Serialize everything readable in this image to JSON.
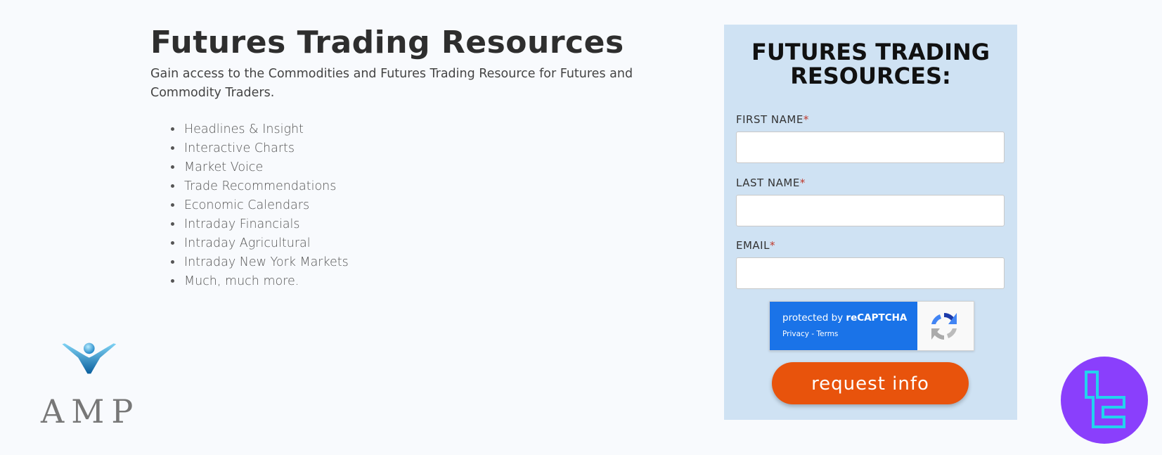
{
  "page": {
    "title": "Futures Trading Resources",
    "intro": "Gain access to the Commodities and Futures Trading Resource for Futures and Commodity Traders.",
    "features": [
      "Headlines & Insight",
      "Interactive Charts",
      "Market Voice",
      "Trade Recommendations",
      "Economic Calendars",
      "Intraday Financials",
      "Intraday Agricultural",
      "Intraday New York Markets",
      "Much, much more."
    ]
  },
  "logo": {
    "text": "AMP",
    "icon": "amp-logo-icon"
  },
  "form": {
    "title_line1": "FUTURES TRADING",
    "title_line2": "RESOURCES:",
    "first_name_label": "FIRST NAME",
    "last_name_label": "LAST NAME",
    "email_label": "EMAIL",
    "required_mark": "*",
    "first_name_value": "",
    "last_name_value": "",
    "email_value": "",
    "recaptcha_prefix": "protected by ",
    "recaptcha_brand": "reCAPTCHA",
    "recaptcha_links": "Privacy - Terms",
    "submit_label": "request info"
  },
  "colors": {
    "background": "#f8fafd",
    "panel": "#cfe2f3",
    "button": "#e8530c",
    "required": "#c0392b",
    "recaptcha_blue": "#1a73e8",
    "badge": "#8a3ffc",
    "badge_accent": "#22d3ee"
  },
  "badge": {
    "icon": "tradingfinder-logo-icon"
  }
}
